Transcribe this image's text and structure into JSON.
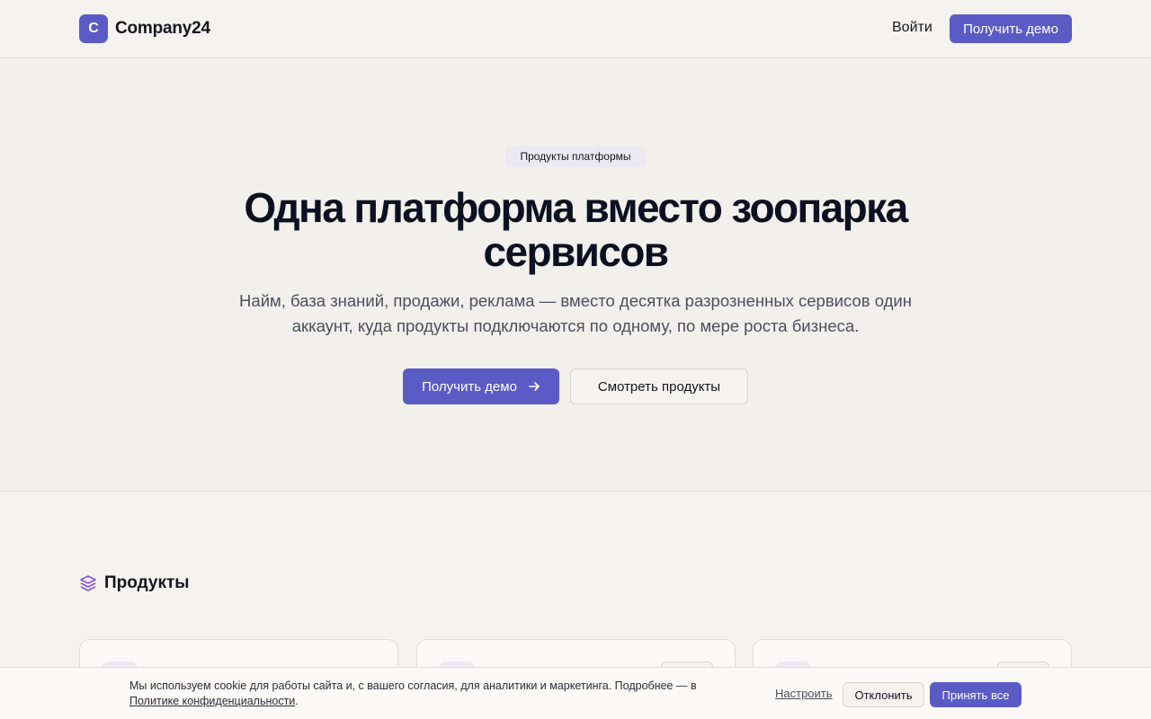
{
  "header": {
    "logo_letter": "C",
    "brand": "Company24",
    "login": "Войти",
    "demo": "Получить демо"
  },
  "hero": {
    "badge": "Продукты платформы",
    "title": "Одна платформа вместо зоопарка сервисов",
    "subtitle": "Найм, база знаний, продажи, реклама — вместо десятка разрозненных сервисов один аккаунт, куда продукты подключаются по одному, по мере роста бизнеса.",
    "cta_primary": "Получить демо",
    "cta_secondary": "Смотреть продукты"
  },
  "products": {
    "title": "Продукты"
  },
  "cookie": {
    "text": "Мы используем cookie для работы сайта и, с вашего согласия, для аналитики и маркетинга. Подробнее — в",
    "policy_link": "Политике конфиденциальности",
    "text_end": ".",
    "configure": "Настроить",
    "decline": "Отклонить",
    "accept": "Принять все"
  },
  "colors": {
    "accent": "#5b5bc6",
    "background": "#f4f3f0",
    "icon_purple": "#7c3aed"
  }
}
